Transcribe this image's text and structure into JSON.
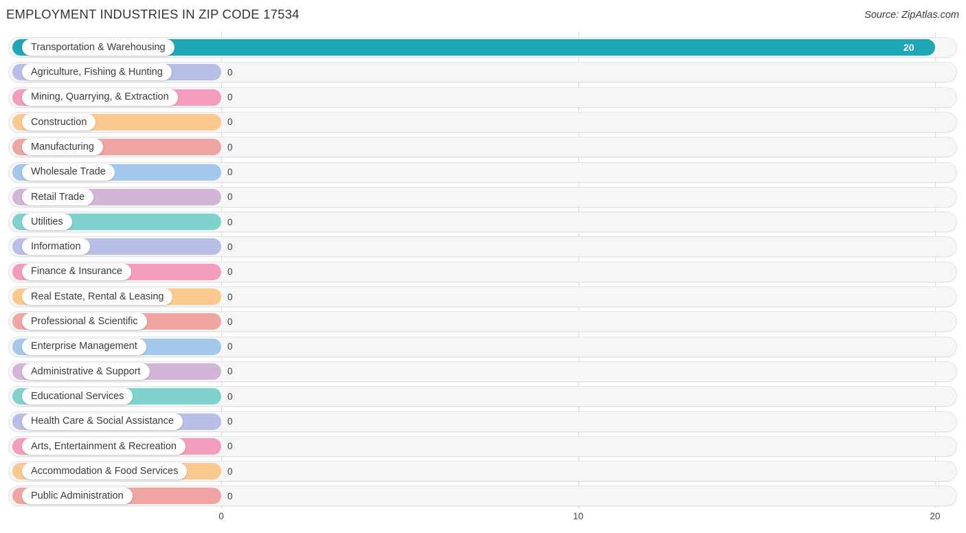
{
  "header": {
    "title": "EMPLOYMENT INDUSTRIES IN ZIP CODE 17534",
    "source": "Source: ZipAtlas.com"
  },
  "chart_data": {
    "type": "bar",
    "orientation": "horizontal",
    "title": "EMPLOYMENT INDUSTRIES IN ZIP CODE 17534",
    "xlabel": "",
    "ylabel": "",
    "xlim": [
      0,
      20
    ],
    "grid": true,
    "legend": "none",
    "ticks": [
      {
        "label": "0",
        "value": 0
      },
      {
        "label": "10",
        "value": 10
      },
      {
        "label": "20",
        "value": 20
      }
    ],
    "categories": [
      "Transportation & Warehousing",
      "Agriculture, Fishing & Hunting",
      "Mining, Quarrying, & Extraction",
      "Construction",
      "Manufacturing",
      "Wholesale Trade",
      "Retail Trade",
      "Utilities",
      "Information",
      "Finance & Insurance",
      "Real Estate, Rental & Leasing",
      "Professional & Scientific",
      "Enterprise Management",
      "Administrative & Support",
      "Educational Services",
      "Health Care & Social Assistance",
      "Arts, Entertainment & Recreation",
      "Accommodation & Food Services",
      "Public Administration"
    ],
    "values": [
      20,
      0,
      0,
      0,
      0,
      0,
      0,
      0,
      0,
      0,
      0,
      0,
      0,
      0,
      0,
      0,
      0,
      0,
      0
    ],
    "value_labels": [
      "20",
      "0",
      "0",
      "0",
      "0",
      "0",
      "0",
      "0",
      "0",
      "0",
      "0",
      "0",
      "0",
      "0",
      "0",
      "0",
      "0",
      "0",
      "0"
    ],
    "colors": [
      "#1EA7B5",
      "#B9BEE8",
      "#F49CBE",
      "#FBC88E",
      "#EFA5A2",
      "#A4C7EC",
      "#D3B6D7",
      "#7FD2CE",
      "#B9BEE8",
      "#F49CBE",
      "#FBC88E",
      "#EFA5A2",
      "#A4C7EC",
      "#D3B6D7",
      "#7FD2CE",
      "#B9BEE8",
      "#F49CBE",
      "#FBC88E",
      "#EFA5A2"
    ]
  }
}
